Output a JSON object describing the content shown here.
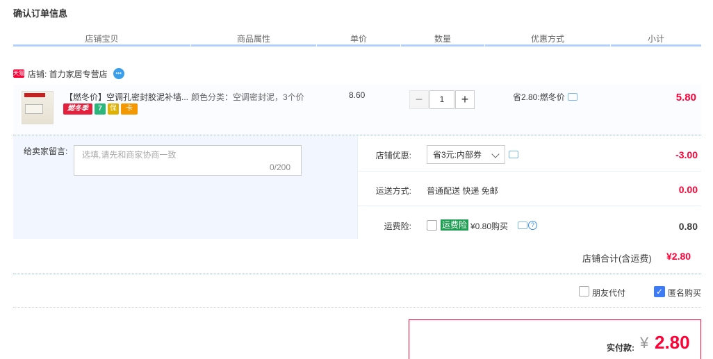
{
  "page_title": "确认订单信息",
  "columns": [
    "店铺宝贝",
    "商品属性",
    "单价",
    "数量",
    "优惠方式",
    "小计"
  ],
  "shop": {
    "tmall_badge": "天猫",
    "label": "店铺: 首力家居专营店",
    "chat_icon": "chat-bubble-icon"
  },
  "item": {
    "title": "【燃冬价】空调孔密封胶泥补墙...",
    "badges": {
      "winter": "燃冬季",
      "seven": "7",
      "shield": "保",
      "card": "卡"
    },
    "attribute": "颜色分类：空调密封泥，3个价",
    "unit_price": "8.60",
    "quantity": "1",
    "qty_minus": "−",
    "qty_plus": "+",
    "discount": "省2.80:燃冬价",
    "subtotal": "5.80"
  },
  "remark": {
    "label": "给卖家留言:",
    "placeholder": "选填,请先和商家协商一致",
    "count": "0/200"
  },
  "options": {
    "shop_discount_label": "店铺优惠:",
    "shop_discount_value": "省3元:内部券",
    "shop_discount_amount": "-3.00",
    "shipping_label": "运送方式:",
    "shipping_value": "普通配送 快递 免邮",
    "shipping_amount": "0.00",
    "insurance_label": "运费险:",
    "insurance_tag": "运费险",
    "insurance_price": "¥0.80购买",
    "insurance_amount": "0.80"
  },
  "shop_total": {
    "label": "店铺合计(含运费)",
    "value": "¥2.80"
  },
  "pay_options": {
    "friend_pay": "朋友代付",
    "anonymous": "匿名购买",
    "anonymous_checked": true
  },
  "payment": {
    "label": "实付款:",
    "currency": "¥",
    "value": "2.80"
  },
  "colors": {
    "accent_red": "#ff0036",
    "header_line": "#b2d1ff",
    "panel_bg": "#f2f7ff"
  }
}
